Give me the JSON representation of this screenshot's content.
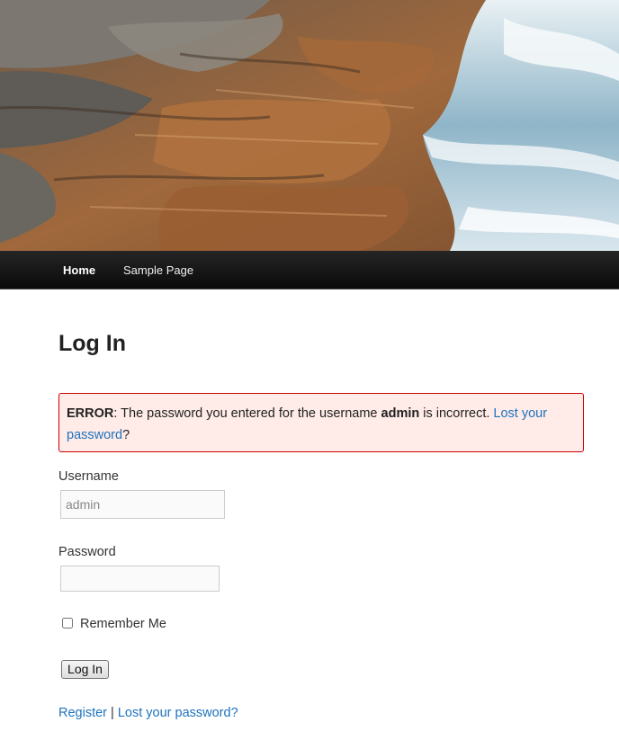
{
  "nav": {
    "items": [
      {
        "label": "Home",
        "active": true
      },
      {
        "label": "Sample Page",
        "active": false
      }
    ]
  },
  "page": {
    "title": "Log In"
  },
  "error": {
    "prefix": "ERROR",
    "message_before_user": ": The password you entered for the username ",
    "username": "admin",
    "message_after_user": " is incorrect. ",
    "link_text": "Lost your password",
    "suffix": "?"
  },
  "form": {
    "username_label": "Username",
    "username_value": "admin",
    "password_label": "Password",
    "password_value": "",
    "remember_label": "Remember Me",
    "remember_checked": false,
    "submit_label": "Log In"
  },
  "footer": {
    "register_label": "Register",
    "separator": "|",
    "lost_password_label": "Lost your password?"
  },
  "colors": {
    "link": "#1e73be",
    "error_bg": "#ffebe8",
    "error_border": "#cc0000",
    "nav_bg": "#111111"
  }
}
